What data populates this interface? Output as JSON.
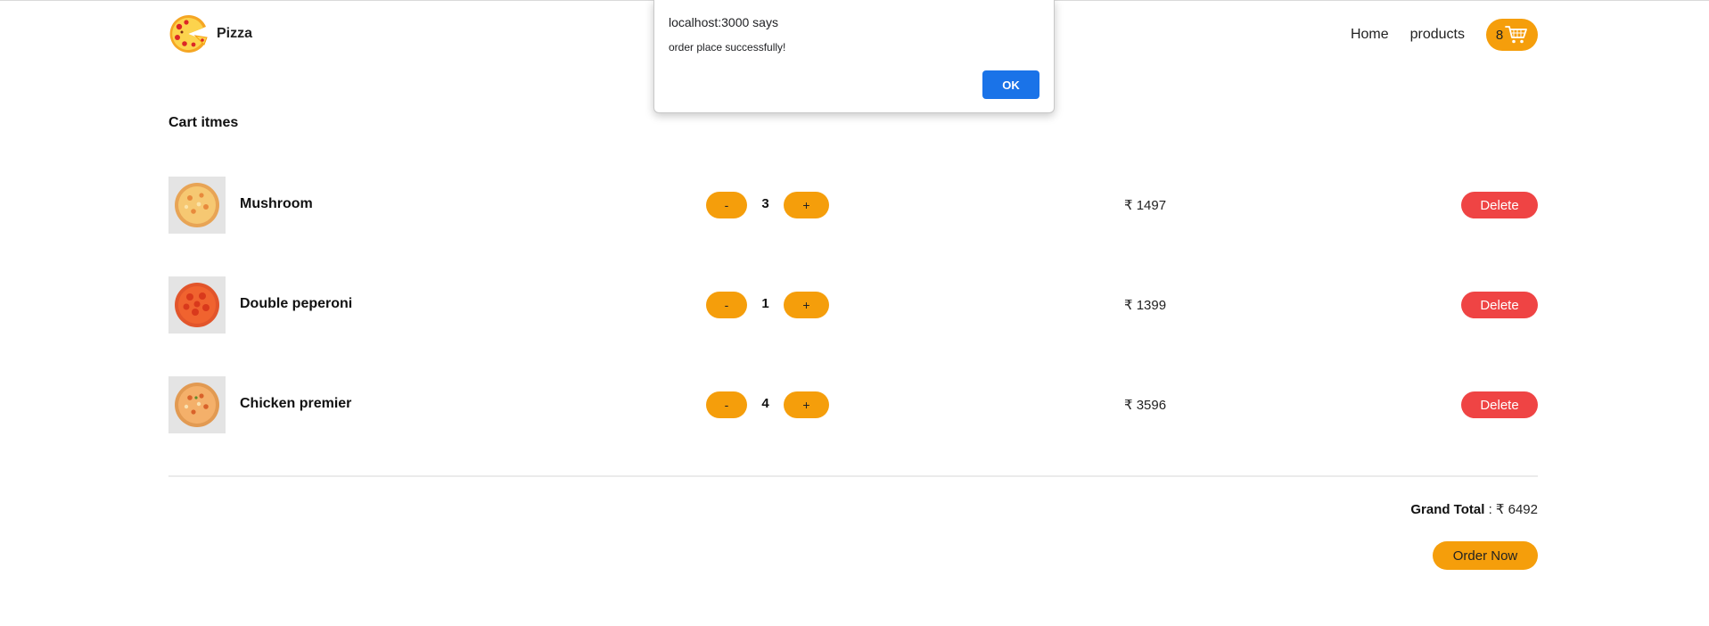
{
  "navbar": {
    "brand": "Pizza",
    "logo_icon": "pizza-icon",
    "links": [
      "Home",
      "products"
    ],
    "cart_count": "8",
    "cart_icon": "shopping-cart-icon"
  },
  "cart": {
    "title": "Cart itmes",
    "items": [
      {
        "name": "Mushroom",
        "qty": "3",
        "price": "₹ 1497",
        "minus": "-",
        "plus": "+",
        "delete": "Delete",
        "thumb_icon": "pizza-thumbnail"
      },
      {
        "name": "Double peperoni",
        "qty": "1",
        "price": "₹ 1399",
        "minus": "-",
        "plus": "+",
        "delete": "Delete",
        "thumb_icon": "pizza-thumbnail"
      },
      {
        "name": "Chicken premier",
        "qty": "4",
        "price": "₹ 3596",
        "minus": "-",
        "plus": "+",
        "delete": "Delete",
        "thumb_icon": "pizza-thumbnail"
      }
    ],
    "grand_total_label": "Grand Total",
    "grand_total_value": " : ₹ 6492",
    "order_button": "Order Now"
  },
  "alert": {
    "title": "localhost:3000 says",
    "message": "order place successfully!",
    "ok": "OK"
  },
  "colors": {
    "accent": "#f59e0b",
    "danger": "#ef4444",
    "dialog_button": "#1a73e8"
  }
}
